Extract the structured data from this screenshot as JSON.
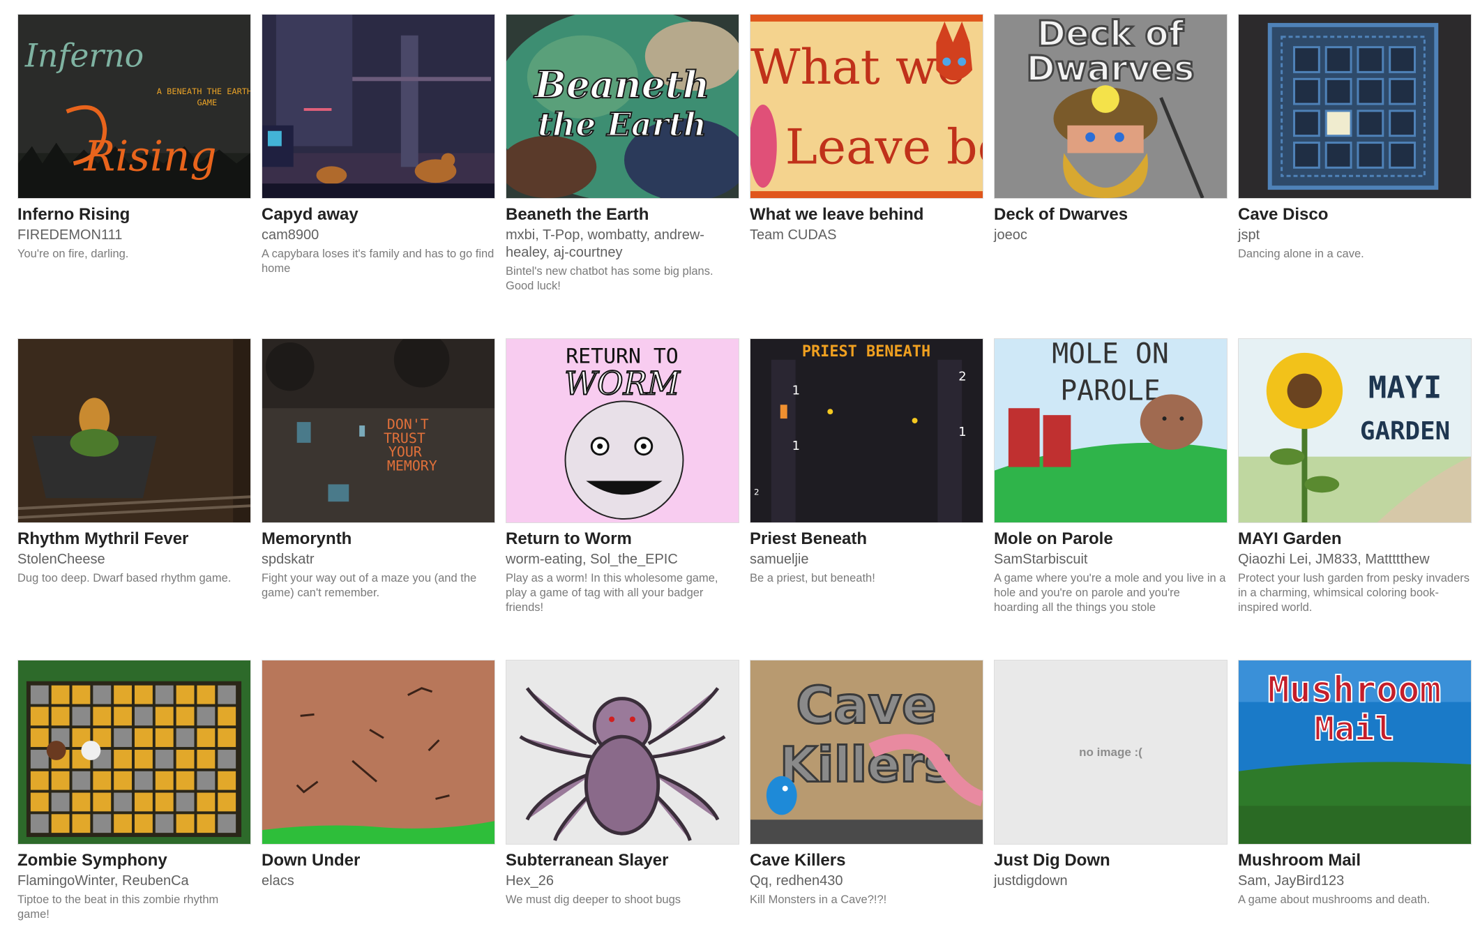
{
  "games": [
    {
      "id": "inferno-rising",
      "title": "Inferno Rising",
      "author": "FIREDEMON111",
      "description": "You're on fire, darling.",
      "art": {
        "logo_top": "Inferno",
        "logo_bottom": "Rising",
        "tagline": "A BENEATH THE EARTH GAME"
      }
    },
    {
      "id": "capyd-away",
      "title": "Capyd away",
      "author": "cam8900",
      "description": "A capybara loses it's family and has to go find home",
      "art": {}
    },
    {
      "id": "beaneth-the-earth",
      "title": "Beaneth the Earth",
      "author": "mxbi, T-Pop, wombatty, andrew-healey, aj-courtney",
      "description": "Bintel's new chatbot has some big plans. Good luck!",
      "art": {
        "logo_top": "Beaneth",
        "logo_bottom": "the Earth"
      }
    },
    {
      "id": "what-we-leave-behind",
      "title": "What we leave behind",
      "author": "Team CUDAS",
      "description": "",
      "art": {
        "logo_top": "What we",
        "logo_bottom": "Leave behi"
      }
    },
    {
      "id": "deck-of-dwarves",
      "title": "Deck of Dwarves",
      "author": "joeoc",
      "description": "",
      "art": {
        "logo_top": "Deck of",
        "logo_bottom": "Dwarves"
      }
    },
    {
      "id": "cave-disco",
      "title": "Cave Disco",
      "author": "jspt",
      "description": "Dancing alone in a cave.",
      "art": {}
    },
    {
      "id": "rhythm-mythril-fever",
      "title": "Rhythm Mythril Fever",
      "author": "StolenCheese",
      "description": "Dug too deep. Dwarf based rhythm game.",
      "art": {}
    },
    {
      "id": "memorynth",
      "title": "Memorynth",
      "author": "spdskatr",
      "description": "Fight your way out of a maze you (and the game) can't remember.",
      "art": {
        "sign": [
          "DON'T",
          "TRUST",
          "YOUR",
          "MEMORY"
        ]
      }
    },
    {
      "id": "return-to-worm",
      "title": "Return to Worm",
      "author": "worm-eating, Sol_the_EPIC",
      "description": "Play as a worm! In this wholesome game, play a game of tag with all your badger friends!",
      "art": {
        "logo_top": "RETURN TO",
        "logo_bottom": "WORM"
      }
    },
    {
      "id": "priest-beneath",
      "title": "Priest Beneath",
      "author": "samueljie",
      "description": "Be a priest, but beneath!",
      "art": {
        "logo_top": "PRIEST BENEATH",
        "numbers": [
          "1",
          "2",
          "1",
          "1",
          "2"
        ]
      }
    },
    {
      "id": "mole-on-parole",
      "title": "Mole on Parole",
      "author": "SamStarbiscuit",
      "description": "A game where you're a mole and you live in a hole and you're on parole and you're hoarding all the things you stole",
      "art": {
        "logo_top": "MOLE ON",
        "logo_bottom": "PAROLE"
      }
    },
    {
      "id": "mayi-garden",
      "title": "MAYI Garden",
      "author": "Qiaozhi Lei, JM833, Mattttthew",
      "description": "Protect your lush garden from pesky invaders in a charming, whimsical coloring book-inspired world.",
      "art": {
        "logo_top": "MAYI",
        "logo_bottom": "GARDEN"
      }
    },
    {
      "id": "zombie-symphony",
      "title": "Zombie Symphony",
      "author": "FlamingoWinter, ReubenCa",
      "description": "Tiptoe to the beat in this zombie rhythm game!",
      "art": {}
    },
    {
      "id": "down-under",
      "title": "Down Under",
      "author": "elacs",
      "description": "",
      "art": {}
    },
    {
      "id": "subterranean-slayer",
      "title": "Subterranean Slayer",
      "author": "Hex_26",
      "description": "We must dig deeper to shoot bugs",
      "art": {}
    },
    {
      "id": "cave-killers",
      "title": "Cave Killers",
      "author": "Qq, redhen430",
      "description": "Kill Monsters in a Cave?!?!",
      "art": {
        "logo_top": "Cave",
        "logo_bottom": "Killers"
      }
    },
    {
      "id": "just-dig-down",
      "title": "Just Dig Down",
      "author": "justdigdown",
      "description": "",
      "art": {
        "no_image": "no image :("
      }
    },
    {
      "id": "mushroom-mail",
      "title": "Mushroom Mail",
      "author": "Sam, JayBird123",
      "description": "A game about mushrooms and death.",
      "art": {
        "logo_top": "Mushroom",
        "logo_bottom": "Mail"
      }
    }
  ]
}
